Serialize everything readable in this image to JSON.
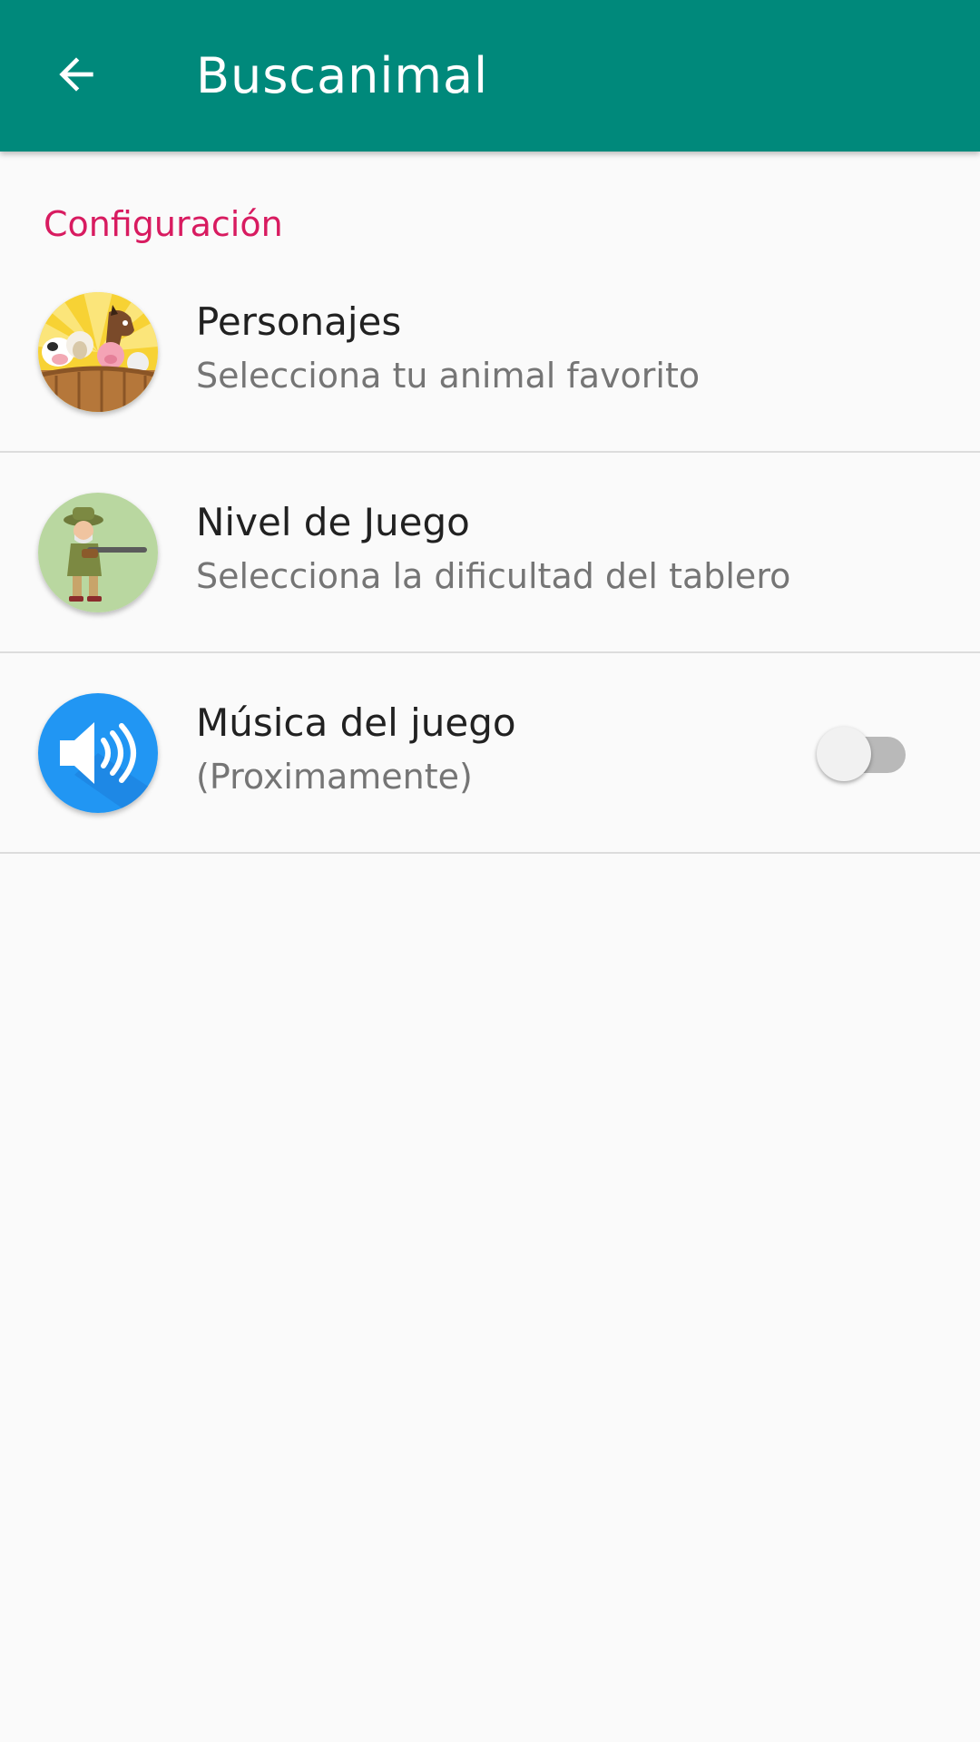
{
  "appbar": {
    "title": "Buscanimal",
    "back_icon": "arrow-left-icon",
    "background": "#00897b"
  },
  "section": {
    "title": "Configuración",
    "color": "#d81b60"
  },
  "preferences": [
    {
      "title": "Personajes",
      "summary": "Selecciona tu animal favorito",
      "icon": "farm-animals-icon"
    },
    {
      "title": "Nivel de Juego",
      "summary": "Selecciona la dificultad del tablero",
      "icon": "hunter-icon"
    },
    {
      "title": "Música del juego",
      "summary": "(Proximamente)",
      "icon": "speaker-icon",
      "toggle": {
        "checked": false
      }
    }
  ]
}
